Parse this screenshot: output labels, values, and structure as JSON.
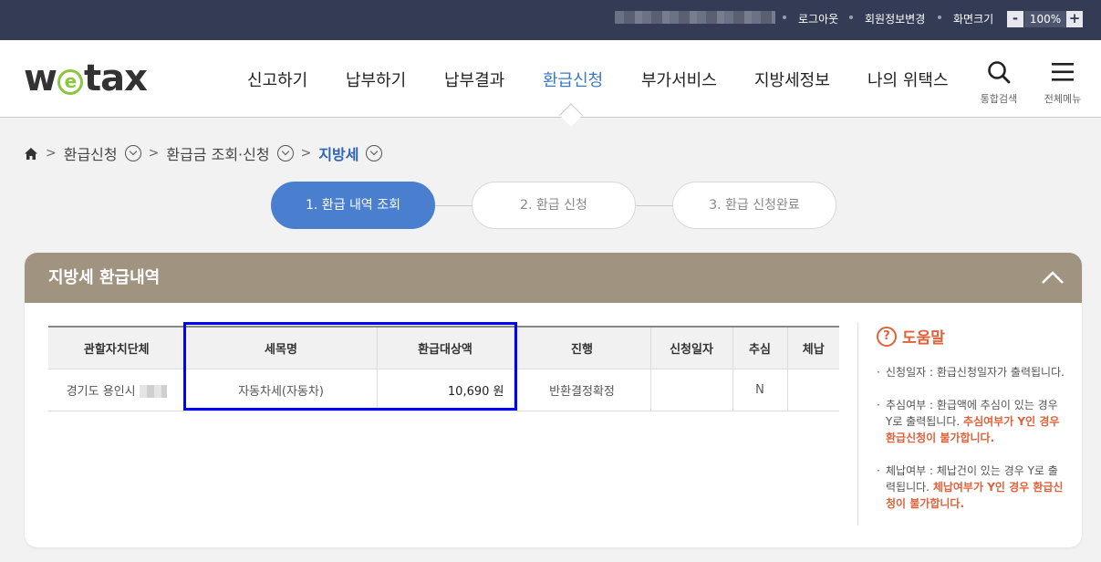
{
  "topbar": {
    "logout": "로그아웃",
    "member_info": "회원정보변경",
    "screen_size": "화면크기",
    "zoom_minus": "-",
    "zoom_value": "100%",
    "zoom_plus": "+"
  },
  "header": {
    "logo_pre": "w",
    "logo_e": "e",
    "logo_post": "tax",
    "nav": [
      "신고하기",
      "납부하기",
      "납부결과",
      "환급신청",
      "부가서비스",
      "지방세정보",
      "나의 위택스"
    ],
    "active_nav": "환급신청",
    "search_label": "통합검색",
    "menu_label": "전체메뉴"
  },
  "breadcrumb": {
    "items": [
      "환급신청",
      "환급금 조회·신청",
      "지방세"
    ]
  },
  "steps": [
    "1. 환급 내역 조회",
    "2. 환급 신청",
    "3. 환급 신청완료"
  ],
  "panel": {
    "title": "지방세 환급내역",
    "columns": [
      "관할자치단체",
      "세목명",
      "환급대상액",
      "진행",
      "신청일자",
      "추심",
      "체납"
    ],
    "rows": [
      {
        "region": "경기도 용인시",
        "tax_name": "자동차세(자동차)",
        "amount": "10,690 원",
        "status": "반환결정확정",
        "date": "",
        "collection": "N",
        "arrears": ""
      }
    ]
  },
  "help": {
    "title": "도움말",
    "icon_char": "?",
    "item1": "신청일자 : 환급신청일자가 출력됩니다.",
    "item2": "추심여부 : 환급액에 추심이 있는 경우 Y로 출력됩니다.",
    "item2_warn": "추심여부가 Y인 경우 환급신청이 불가합니다.",
    "item3": "체납여부 : 체납건이 있는 경우 Y로 출력됩니다.",
    "item3_warn": "체납여부가 Y인 경우 환급신청이 불가합니다."
  },
  "colors": {
    "topbar": "#333c54",
    "active_nav": "#3a78c9",
    "step_active": "#4a7fcf",
    "panel_header": "#a09480",
    "warning": "#e0613a",
    "highlight_box": "#0000ff"
  }
}
